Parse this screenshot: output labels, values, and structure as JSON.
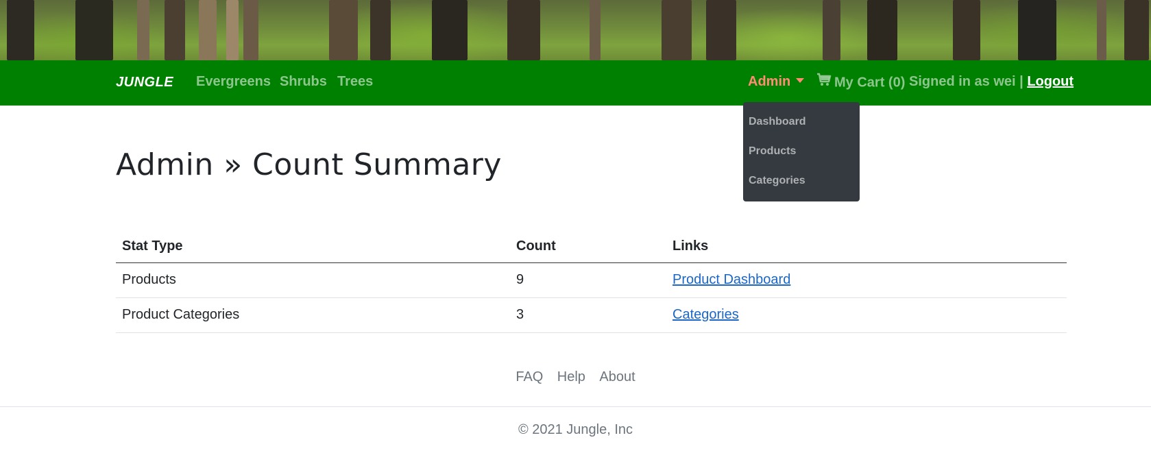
{
  "navbar": {
    "brand": "JUNGLE",
    "links": [
      "Evergreens",
      "Shrubs",
      "Trees"
    ],
    "admin_label": "Admin",
    "cart_label": "My Cart (0)",
    "signed_in_text": "Signed in as wei |",
    "logout_label": "Logout",
    "admin_dropdown": [
      "Dashboard",
      "Products",
      "Categories"
    ],
    "colors": {
      "navbar_bg": "#008000",
      "admin_accent": "#ff8c73",
      "dropdown_bg": "#343a40"
    },
    "icons": {
      "cart": "shopping-cart-icon",
      "caret": "chevron-down-icon"
    }
  },
  "page": {
    "title": "Admin » Count Summary"
  },
  "table": {
    "headers": [
      "Stat Type",
      "Count",
      "Links"
    ],
    "rows": [
      {
        "stat": "Products",
        "count": "9",
        "link": "Product Dashboard"
      },
      {
        "stat": "Product Categories",
        "count": "3",
        "link": "Categories"
      }
    ],
    "link_color": "#1a66c9"
  },
  "footer": {
    "links": [
      "FAQ",
      "Help",
      "About"
    ],
    "copyright": "© 2021 Jungle, Inc"
  }
}
